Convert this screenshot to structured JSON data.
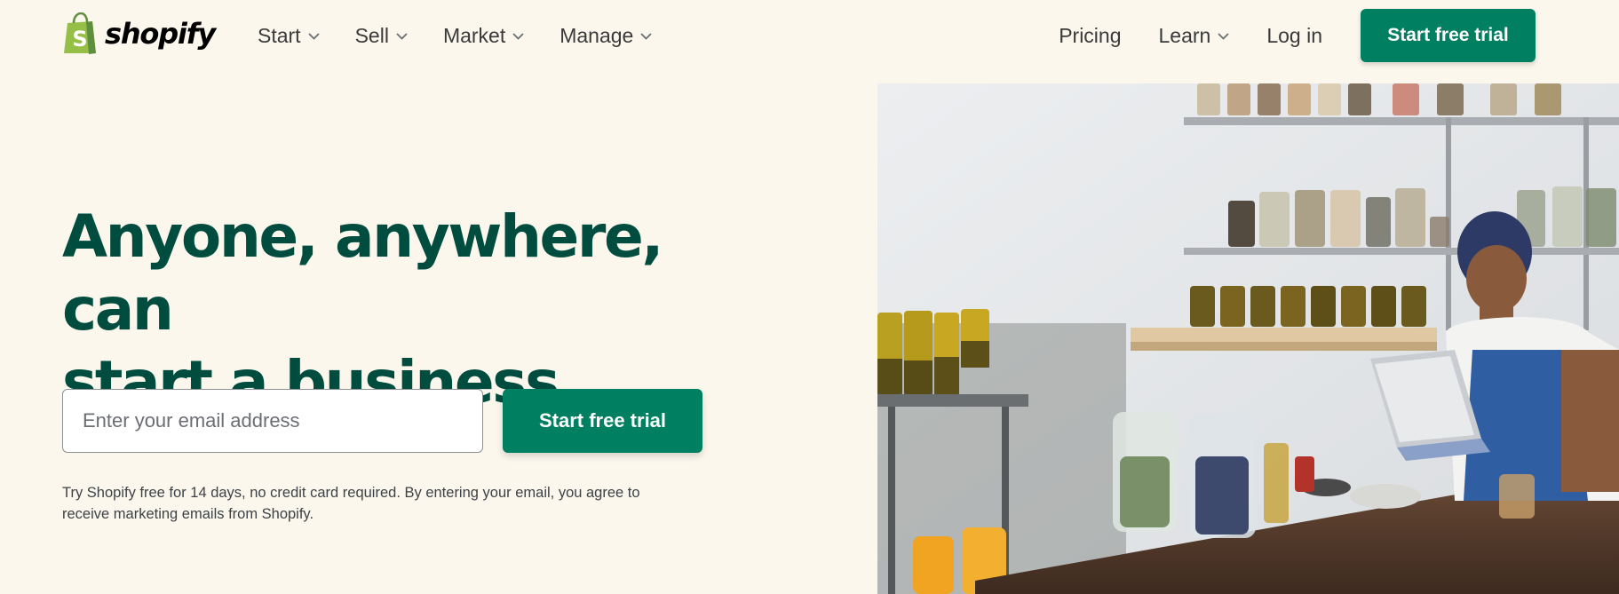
{
  "brand": {
    "name": "shopify",
    "logo_icon": "shopping-bag-icon",
    "colors": {
      "primary": "#008060",
      "headline": "#004c3f",
      "background": "#fbf7ed",
      "logo_green": "#95bf47"
    }
  },
  "nav": {
    "left": [
      {
        "label": "Start",
        "icon": "chevron-down-icon"
      },
      {
        "label": "Sell",
        "icon": "chevron-down-icon"
      },
      {
        "label": "Market",
        "icon": "chevron-down-icon"
      },
      {
        "label": "Manage",
        "icon": "chevron-down-icon"
      }
    ],
    "pricing": "Pricing",
    "learn": "Learn",
    "login": "Log in",
    "cta": "Start free trial"
  },
  "hero": {
    "headline_line1": "Anyone, anywhere, can",
    "headline_line2": "start a business",
    "email_placeholder": "Enter your email address",
    "cta": "Start free trial",
    "disclaimer_line1": "Try Shopify free for 14 days, no credit card required. By entering your email, you agree to",
    "disclaimer_line2": "receive marketing emails from Shopify."
  }
}
